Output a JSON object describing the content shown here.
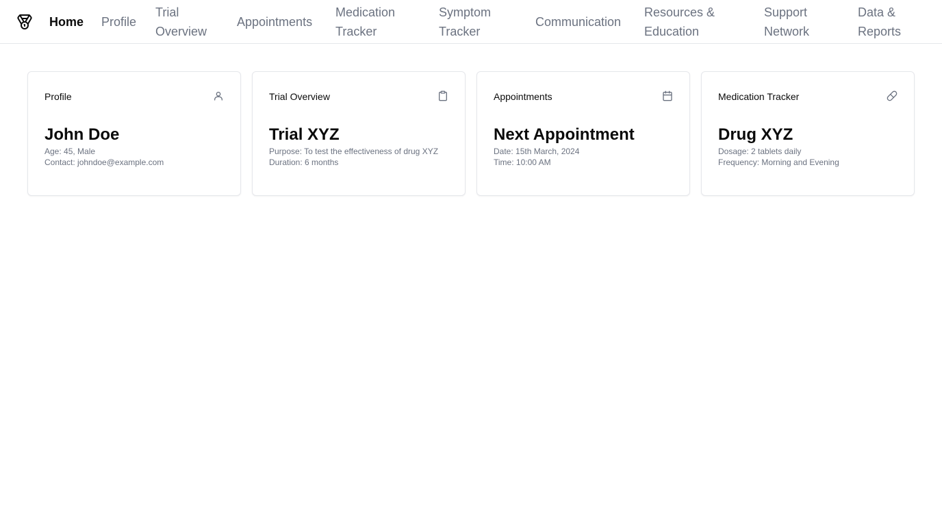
{
  "nav": {
    "logo_icon": "medal-icon",
    "items": [
      {
        "label": "Home",
        "active": true
      },
      {
        "label": "Profile"
      },
      {
        "label": "Trial",
        "label2": "Overview"
      },
      {
        "label": "Appointments"
      },
      {
        "label": "Medication",
        "label2": "Tracker"
      },
      {
        "label": "Symptom",
        "label2": "Tracker"
      },
      {
        "label": "Communication"
      },
      {
        "label": "Resources &",
        "label2": "Education"
      },
      {
        "label": "Support",
        "label2": "Network"
      },
      {
        "label": "Data &",
        "label2": "Reports"
      }
    ]
  },
  "cards": [
    {
      "title": "Profile",
      "icon": "user-icon",
      "headline": "John Doe",
      "lines": [
        "Age: 45, Male",
        "Contact: johndoe@example.com"
      ]
    },
    {
      "title": "Trial Overview",
      "icon": "clipboard-icon",
      "headline": "Trial XYZ",
      "lines": [
        "Purpose: To test the effectiveness of drug XYZ",
        "Duration: 6 months"
      ]
    },
    {
      "title": "Appointments",
      "icon": "calendar-icon",
      "headline": "Next Appointment",
      "lines": [
        "Date: 15th March, 2024",
        "Time: 10:00 AM"
      ]
    },
    {
      "title": "Medication Tracker",
      "icon": "pill-icon",
      "headline": "Drug XYZ",
      "lines": [
        "Dosage: 2 tablets daily",
        "Frequency: Morning and Evening"
      ]
    }
  ]
}
